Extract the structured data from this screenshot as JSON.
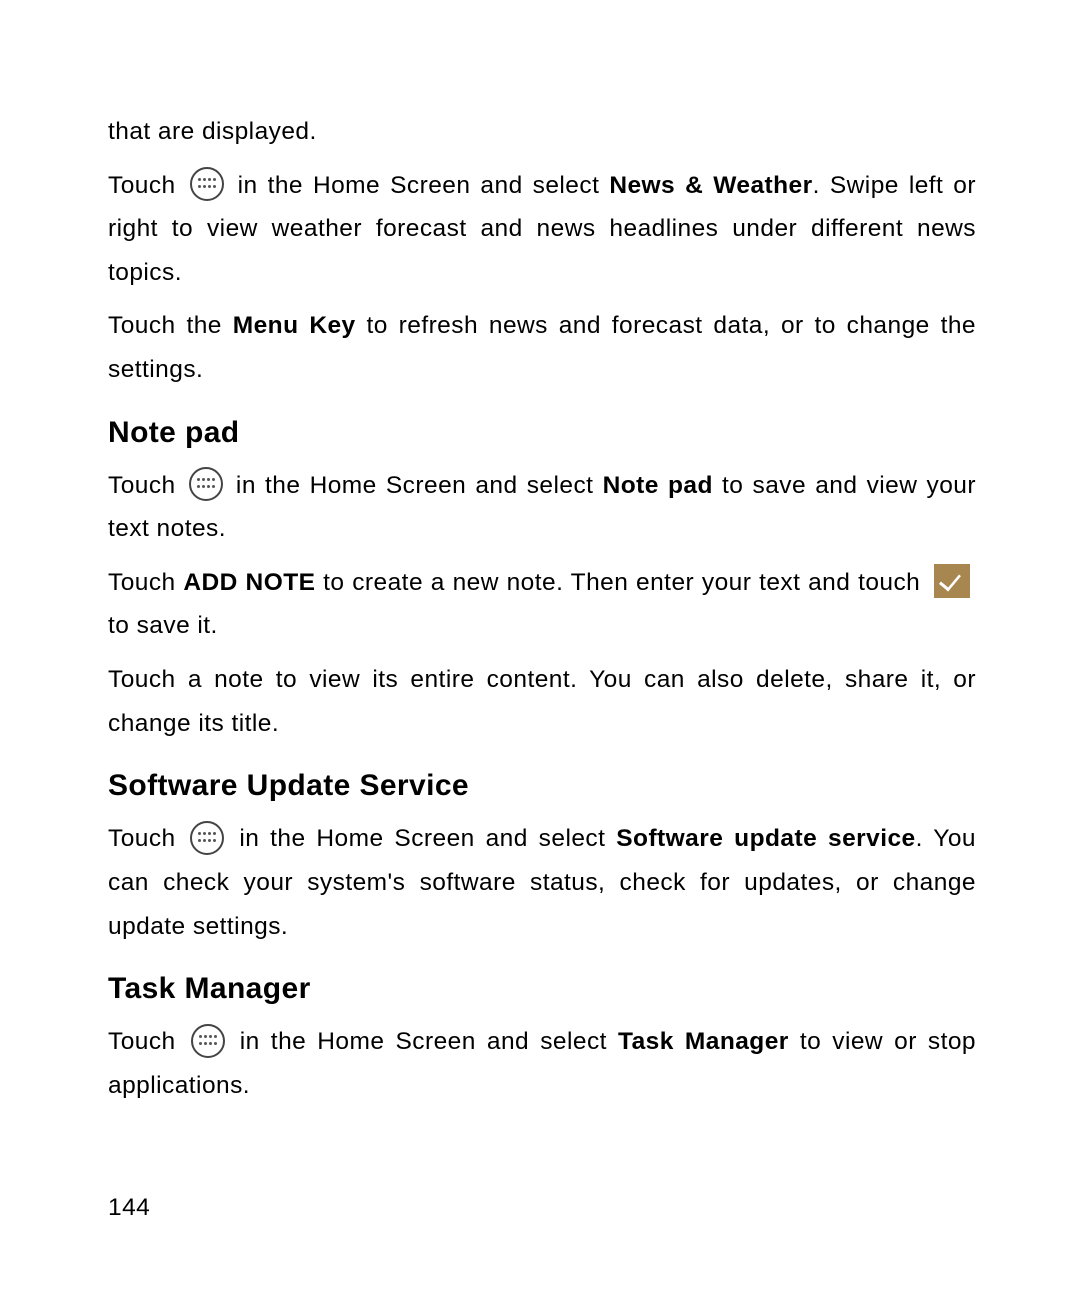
{
  "intro": {
    "line1": "that are displayed.",
    "p1a": "Touch ",
    "p1b": "  in the Home Screen and select ",
    "p1c": "News & Weather",
    "p1d": ". Swipe left or right to view weather forecast and news headlines under different news topics.",
    "p2a": "Touch the ",
    "p2b": "Menu Key",
    "p2c": " to refresh news and forecast data, or to change the settings."
  },
  "notepad": {
    "heading": "Note pad",
    "p1a": "Touch ",
    "p1b": " in the Home Screen and select ",
    "p1c": "Note pad",
    "p1d": " to save and view your text notes.",
    "p2a": "Touch ",
    "p2b": "ADD NOTE",
    "p2c": " to create a new note. Then enter your text and touch ",
    "p2d": " to save it.",
    "p3": "Touch a note to view its entire content. You can also delete, share it, or change its title."
  },
  "sus": {
    "heading": "Software Update Service",
    "p1a": "Touch ",
    "p1b": " in the Home Screen and select ",
    "p1c": "Software update service",
    "p1d": ". You can check your system's software status, check for updates, or change update settings."
  },
  "tm": {
    "heading": "Task Manager",
    "p1a": "Touch ",
    "p1b": " in the Home Screen and select ",
    "p1c": "Task Manager",
    "p1d": " to view or stop applications."
  },
  "page_number": "144"
}
